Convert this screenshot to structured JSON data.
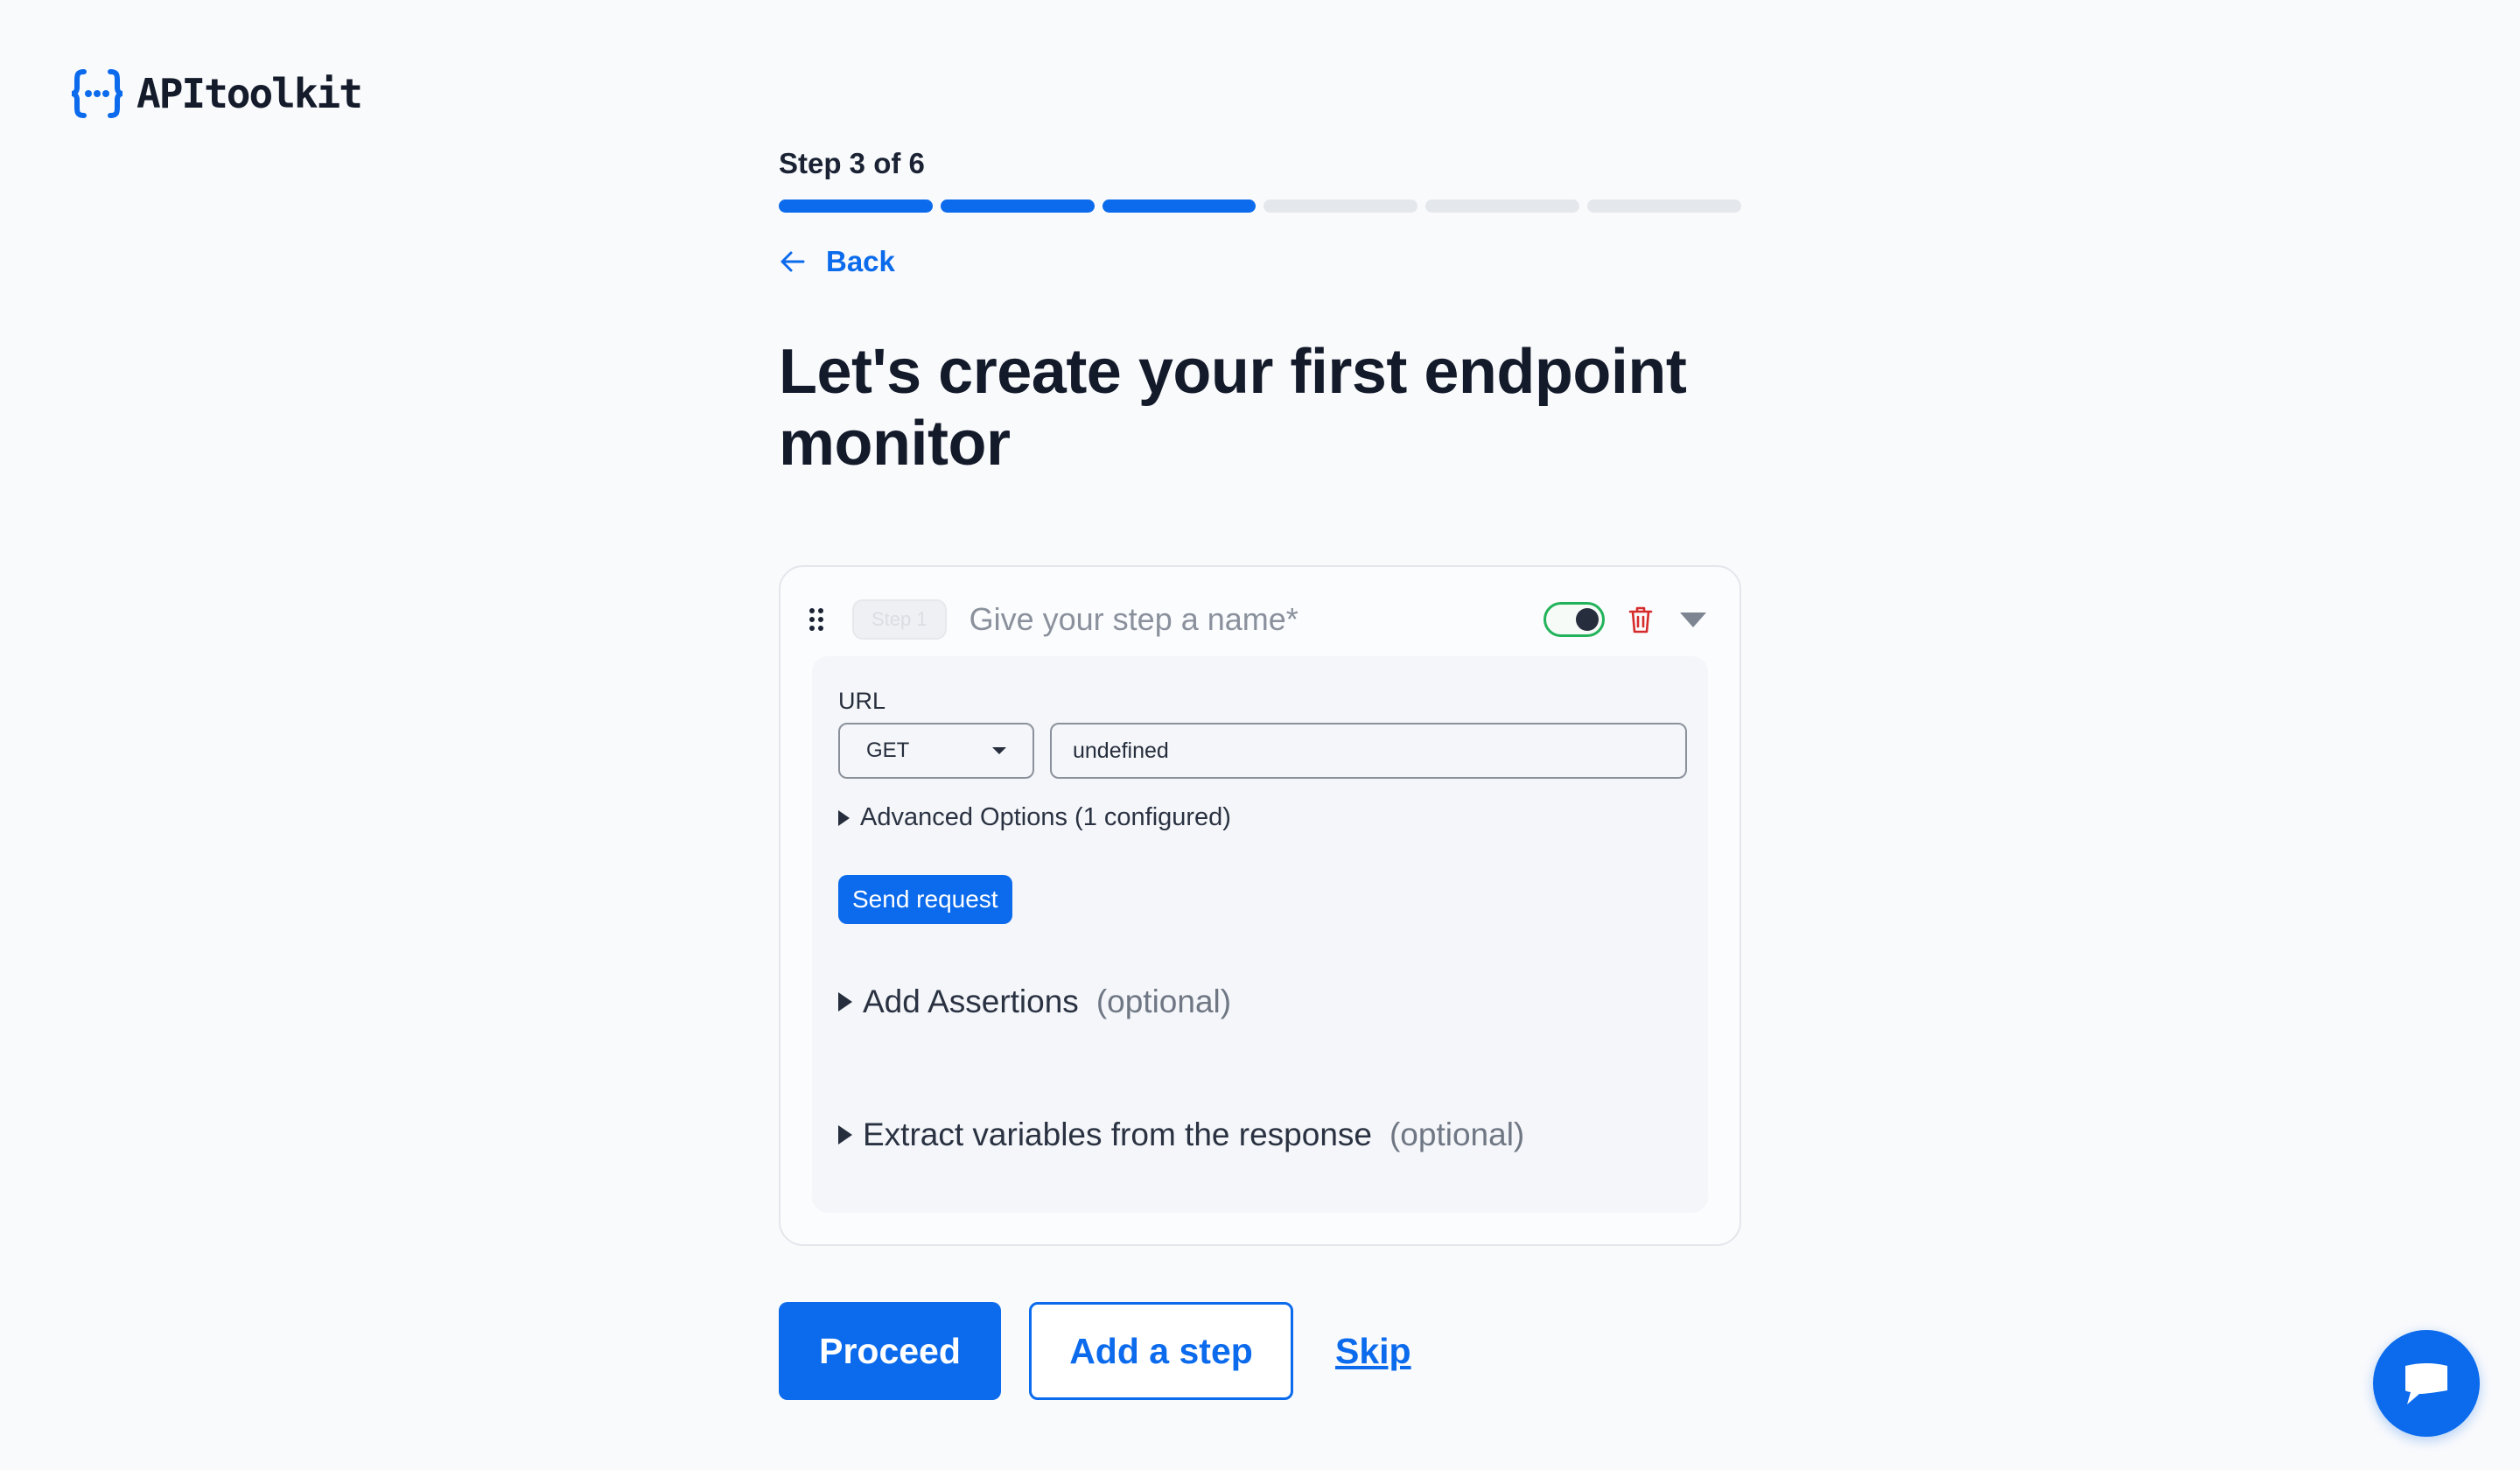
{
  "brand": {
    "name": "APItoolkit",
    "color": "#0b6bec"
  },
  "progress": {
    "label": "Step 3 of 6",
    "current": 3,
    "total": 6
  },
  "nav": {
    "back_label": "Back"
  },
  "page": {
    "title": "Let's create your first endpoint monitor"
  },
  "step": {
    "pill_label": "Step 1",
    "name_placeholder": "Give your step a name*",
    "enabled": true,
    "url_label": "URL",
    "method": "GET",
    "url_value": "undefined",
    "advanced_label": "Advanced Options (1 configured)",
    "send_label": "Send request",
    "assertions_label": "Add Assertions",
    "assertions_optional": "(optional)",
    "extract_label": "Extract variables from the response",
    "extract_optional": "(optional)"
  },
  "actions": {
    "proceed_label": "Proceed",
    "add_step_label": "Add a step",
    "skip_label": "Skip"
  },
  "icons": {
    "logo": "braces-logo-icon",
    "back": "arrow-left-icon",
    "drag": "drag-handle-icon",
    "delete": "trash-icon",
    "expand": "chevron-down-icon",
    "chat": "chat-bubble-icon"
  }
}
